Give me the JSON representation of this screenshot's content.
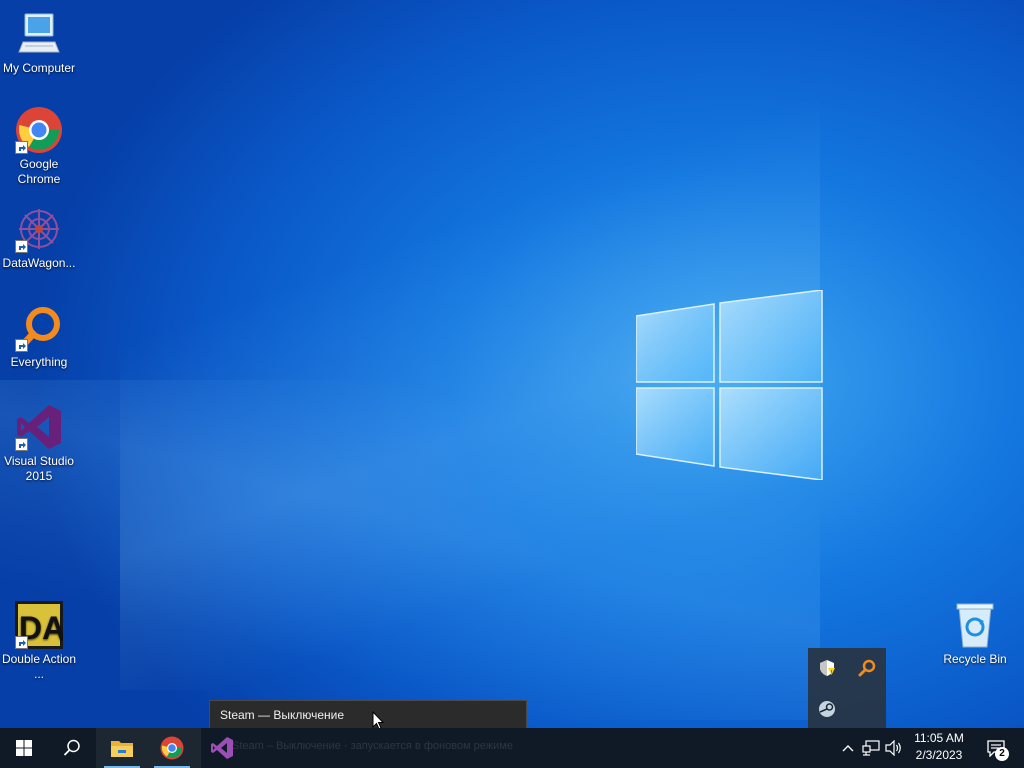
{
  "desktop": {
    "icons": [
      {
        "label": "My Computer"
      },
      {
        "label": "Google Chrome"
      },
      {
        "label": "DataWagon..."
      },
      {
        "label": "Everything"
      },
      {
        "label": "Visual Studio 2015"
      },
      {
        "label": "Double Action ..."
      },
      {
        "label": "Recycle Bin"
      }
    ]
  },
  "tooltip": {
    "text": "Steam — Выключение",
    "ghost_text": "Steam – Выключение · запускается в фоновом режиме"
  },
  "taskbar": {
    "start": "start-icon",
    "search": "search-icon",
    "pinned": [
      {
        "icon": "file-explorer-icon"
      },
      {
        "icon": "chrome-icon"
      },
      {
        "icon": "visual-studio-icon"
      }
    ]
  },
  "tray": {
    "overflow_icons": [
      "windows-security-warning-icon",
      "everything-search-icon",
      "steam-icon"
    ],
    "clock_time": "11:05 AM",
    "clock_date": "2/3/2023",
    "notification_count": "2"
  },
  "colors": {
    "accent": "#76b9ed",
    "taskbar": "#0f1a26",
    "desktop": "#1478e0"
  }
}
